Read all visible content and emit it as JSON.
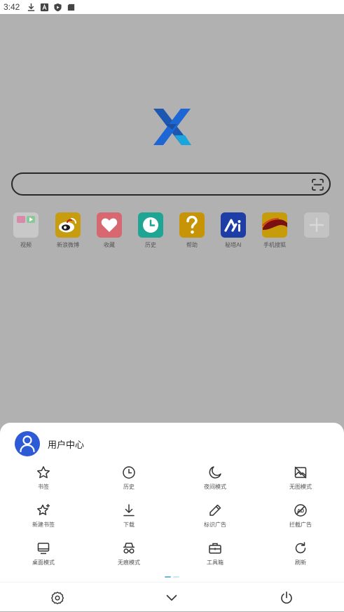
{
  "status_bar": {
    "time": "3:42",
    "icons": [
      "download-icon",
      "font-icon",
      "shield-play-icon",
      "sd-card-icon"
    ]
  },
  "search": {
    "placeholder": ""
  },
  "shortcuts": [
    {
      "label": "视频",
      "icon": "video-folder-icon",
      "color": "#c8c8c8"
    },
    {
      "label": "新浪微博",
      "icon": "weibo-icon",
      "color": "#c79c0f"
    },
    {
      "label": "收藏",
      "icon": "heart-icon",
      "color": "#d76770"
    },
    {
      "label": "历史",
      "icon": "clock-icon",
      "color": "#1fa593"
    },
    {
      "label": "帮助",
      "icon": "question-icon",
      "color": "#c69405"
    },
    {
      "label": "秘塔AI",
      "icon": "metaso-icon",
      "color": "#1d3da7"
    },
    {
      "label": "手机搜狐",
      "icon": "sohu-icon",
      "color": "#c69c0a"
    },
    {
      "label": "",
      "icon": "plus-icon",
      "color": "#c3c3c3"
    }
  ],
  "sheet": {
    "user_center": "用户中心",
    "menu": [
      {
        "label": "书签",
        "icon": "star-icon"
      },
      {
        "label": "历史",
        "icon": "clock-icon"
      },
      {
        "label": "夜间模式",
        "icon": "moon-icon"
      },
      {
        "label": "无图模式",
        "icon": "no-image-icon"
      },
      {
        "label": "新建书签",
        "icon": "star-plus-icon"
      },
      {
        "label": "下载",
        "icon": "download-icon"
      },
      {
        "label": "标识广告",
        "icon": "pencil-icon"
      },
      {
        "label": "拦截广告",
        "icon": "ad-block-icon"
      },
      {
        "label": "桌面模式",
        "icon": "desktop-icon"
      },
      {
        "label": "无痕模式",
        "icon": "incognito-icon"
      },
      {
        "label": "工具箱",
        "icon": "toolbox-icon"
      },
      {
        "label": "刷新",
        "icon": "refresh-icon"
      }
    ],
    "bottom": [
      "settings-icon",
      "chevron-down-icon",
      "power-icon"
    ]
  },
  "colors": {
    "accent": "#2d5bd8",
    "overlay": "#b1b1b1",
    "page_dot": "#6ab6dc"
  }
}
